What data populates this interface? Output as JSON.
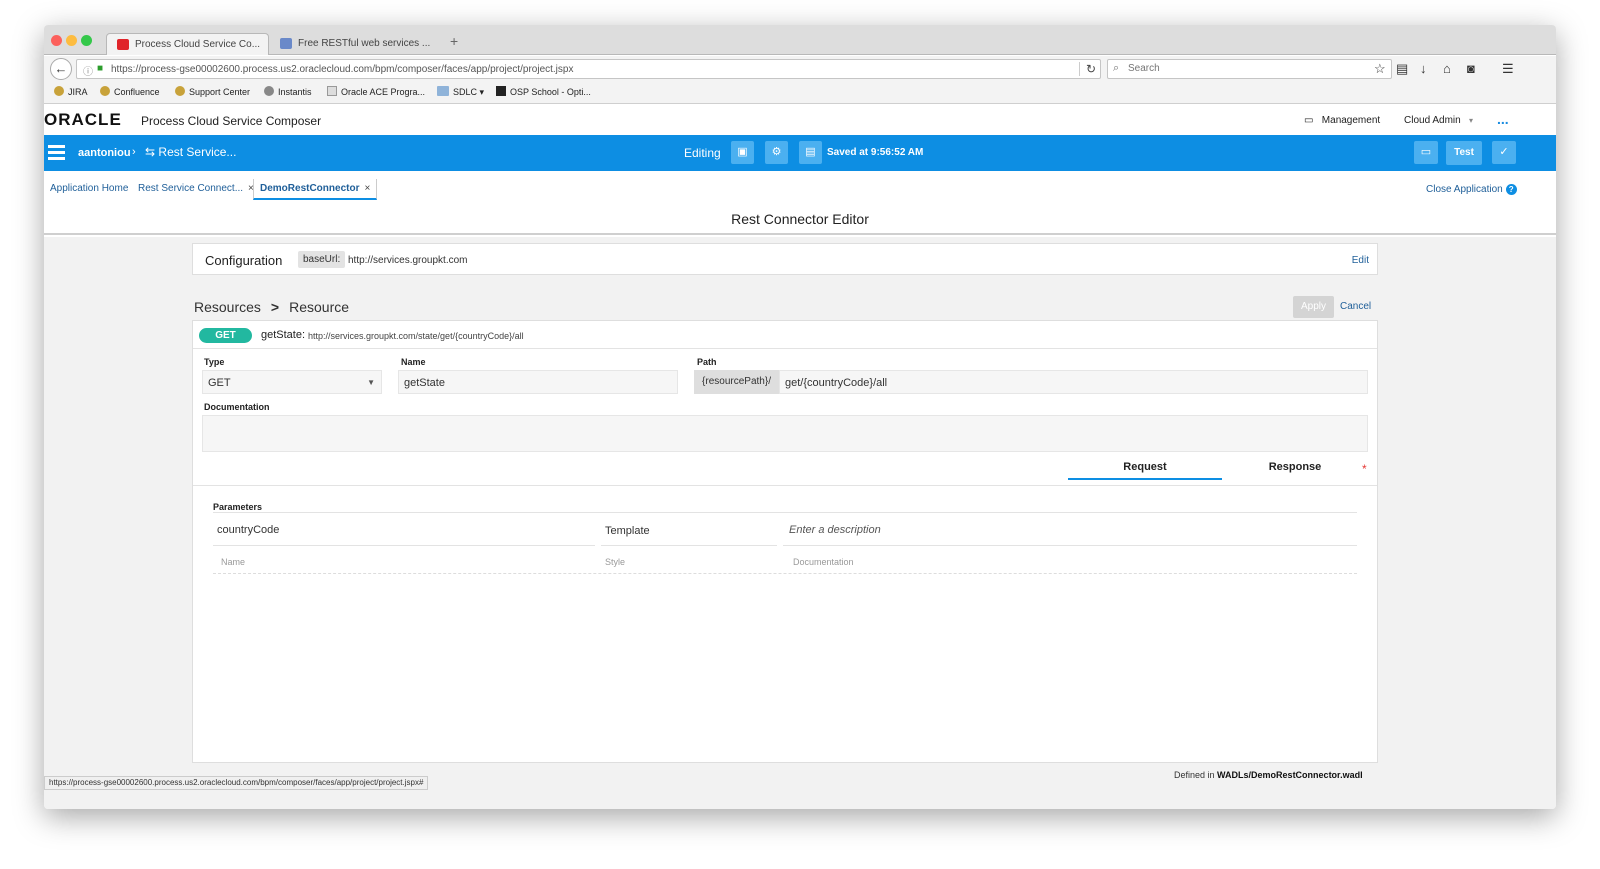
{
  "browser": {
    "tabs": [
      {
        "title": "Process Cloud Service Co...",
        "active": true
      },
      {
        "title": "Free RESTful web services ...",
        "active": false
      }
    ],
    "new_tab": "+",
    "url": "https://process-gse00002600.process.us2.oraclecloud.com/bpm/composer/faces/app/project/project.jspx",
    "search_placeholder": "Search",
    "bookmarks": [
      "JIRA",
      "Confluence",
      "Support Center",
      "Instantis",
      "Oracle ACE Progra...",
      "SDLC",
      "OSP School - Opti..."
    ],
    "status_url": "https://process-gse00002600.process.us2.oraclecloud.com/bpm/composer/faces/app/project/project.jspx#"
  },
  "header": {
    "logo": "ORACLE",
    "app_name": "Process Cloud Service Composer",
    "management": "Management",
    "user_menu": "Cloud Admin",
    "more": "..."
  },
  "bluebar": {
    "user": "aantoniou",
    "separator": "›",
    "service": "Rest Service...",
    "mode": "Editing",
    "saved": "Saved at 9:56:52 AM",
    "test": "Test"
  },
  "apptabs": {
    "items": [
      {
        "label": "Application Home",
        "closable": false
      },
      {
        "label": "Rest Service Connect...",
        "closable": true
      },
      {
        "label": "DemoRestConnector",
        "closable": true
      }
    ],
    "close_x": "×",
    "close_application": "Close Application",
    "help": "?"
  },
  "editor": {
    "title": "Rest Connector Editor",
    "configuration": {
      "label": "Configuration",
      "key": "baseUrl:",
      "value": "http://services.groupkt.com",
      "edit": "Edit"
    },
    "breadcrumb": {
      "first": "Resources",
      "chevron": ">",
      "second": "Resource"
    },
    "apply": "Apply",
    "cancel": "Cancel",
    "resource": {
      "method": "GET",
      "name": "getState:",
      "path": "http://services.groupkt.com/state/get/{countryCode}/all"
    },
    "fields": {
      "type_label": "Type",
      "type_value": "GET",
      "name_label": "Name",
      "name_value": "getState",
      "path_label": "Path",
      "path_prefix": "{resourcePath}/",
      "path_value": "get/{countryCode}/all",
      "doc_label": "Documentation",
      "doc_value": ""
    },
    "tabs": {
      "request": "Request",
      "response": "Response",
      "required_marker": "*"
    },
    "parameters": {
      "label": "Parameters",
      "row": {
        "name": "countryCode",
        "style": "Template",
        "description_placeholder": "Enter a description"
      },
      "headers": {
        "name": "Name",
        "style": "Style",
        "documentation": "Documentation"
      }
    },
    "defined_prefix": "Defined in",
    "defined_file": "WADLs/DemoRestConnector.wadl"
  }
}
